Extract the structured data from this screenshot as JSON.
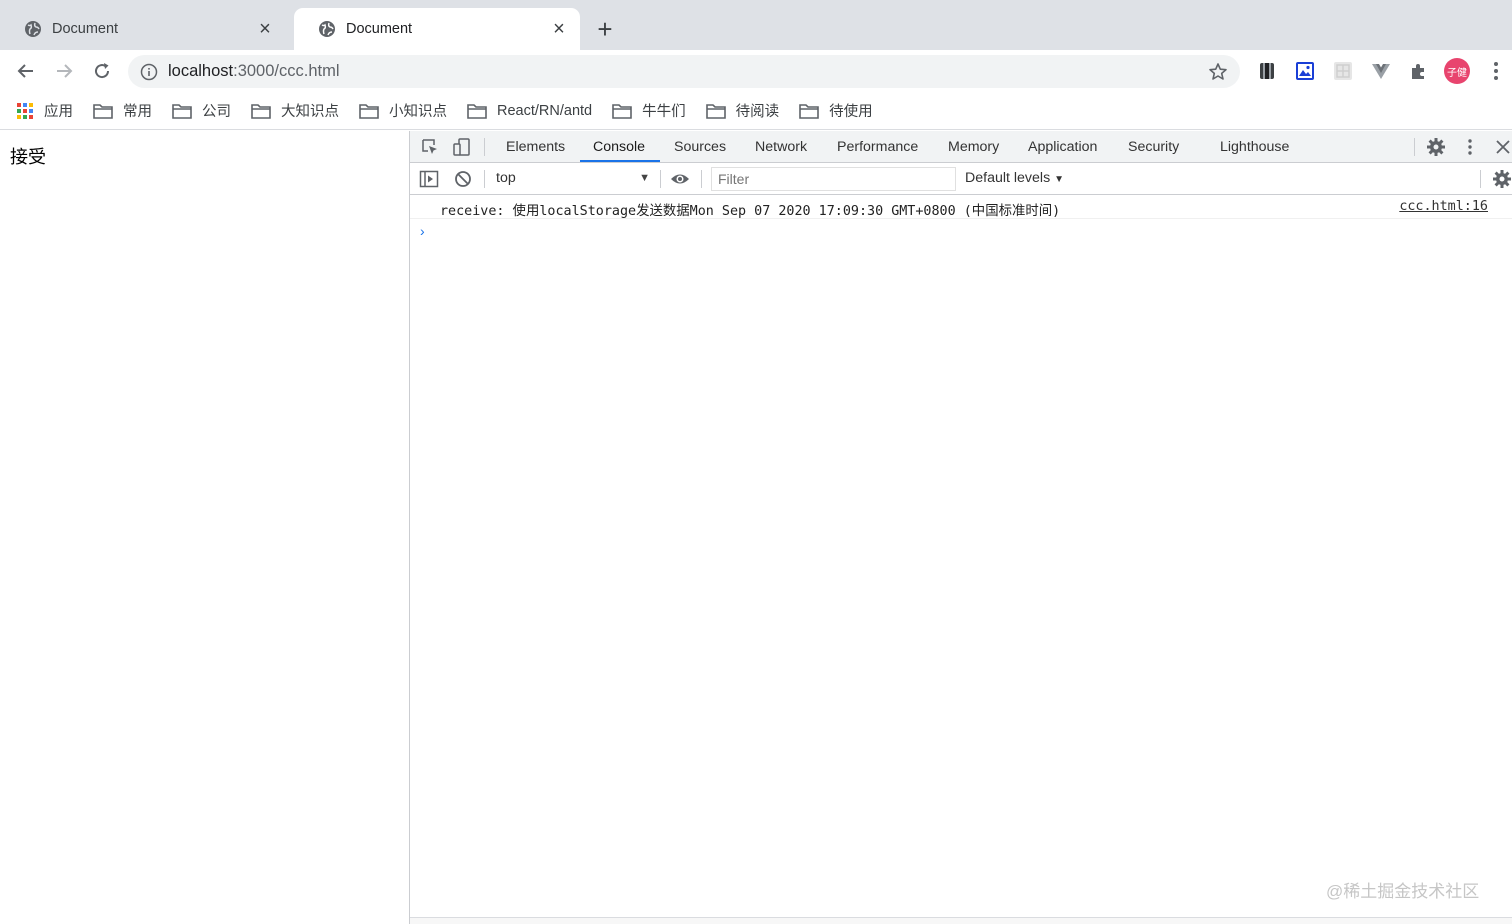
{
  "browser": {
    "tabs": [
      {
        "title": "Document",
        "active": false
      },
      {
        "title": "Document",
        "active": true
      }
    ],
    "address": {
      "host": "localhost",
      "path": ":3000/ccc.html"
    },
    "avatar_text": "子健",
    "bookmarks": [
      {
        "label": "应用",
        "icon": "apps-grid-icon"
      },
      {
        "label": "常用",
        "icon": "folder-icon"
      },
      {
        "label": "公司",
        "icon": "folder-icon"
      },
      {
        "label": "大知识点",
        "icon": "folder-icon"
      },
      {
        "label": "小知识点",
        "icon": "folder-icon"
      },
      {
        "label": "React/RN/antd",
        "icon": "folder-icon"
      },
      {
        "label": "牛牛们",
        "icon": "folder-icon"
      },
      {
        "label": "待阅读",
        "icon": "folder-icon"
      },
      {
        "label": "待使用",
        "icon": "folder-icon"
      }
    ]
  },
  "page": {
    "text": "接受"
  },
  "devtools": {
    "tabs": [
      "Elements",
      "Console",
      "Sources",
      "Network",
      "Performance",
      "Memory",
      "Application",
      "Security",
      "Lighthouse"
    ],
    "active_tab": "Console",
    "context": "top",
    "filter_placeholder": "Filter",
    "levels": "Default levels",
    "log": {
      "message": "receive: 使用localStorage发送数据Mon Sep 07 2020 17:09:30 GMT+0800 (中国标准时间)",
      "source": "ccc.html:16"
    }
  },
  "watermark": "@稀土掘金技术社区",
  "colors": {
    "accent": "#1a73e8",
    "tabstrip": "#dee1e6",
    "avatar": "#e8446e"
  }
}
